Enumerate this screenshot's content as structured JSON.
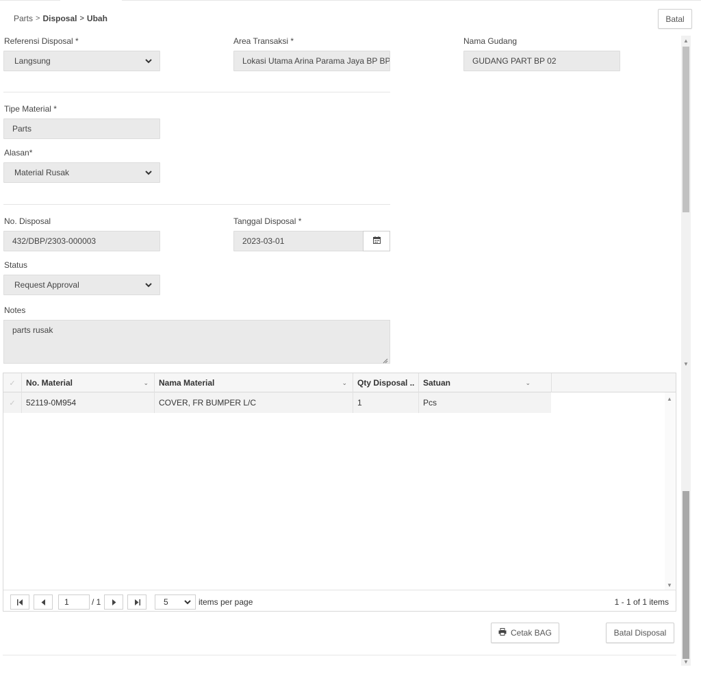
{
  "breadcrumb": {
    "parts": "Parts",
    "disposal": "Disposal",
    "edit": "Ubah",
    "sep": ">"
  },
  "header": {
    "cancel_label": "Batal"
  },
  "form": {
    "referensi_label": "Referensi Disposal *",
    "referensi_value": "Langsung",
    "area_label": "Area Transaksi *",
    "area_value": "Lokasi Utama Arina Parama Jaya BP BP",
    "gudang_label": "Nama Gudang",
    "gudang_value": "GUDANG PART BP 02",
    "tipe_label": "Tipe Material *",
    "tipe_value": "Parts",
    "alasan_label": "Alasan*",
    "alasan_value": "Material Rusak",
    "no_label": "No. Disposal",
    "no_value": "432/DBP/2303-000003",
    "tanggal_label": "Tanggal Disposal *",
    "tanggal_value": "2023-03-01",
    "status_label": "Status",
    "status_value": "Request Approval",
    "notes_label": "Notes",
    "notes_value": "parts rusak"
  },
  "grid": {
    "columns": [
      "No. Material",
      "Nama Material",
      "Qty Disposal ..",
      "Satuan"
    ],
    "rows": [
      {
        "no": "52119-0M954",
        "nama": "COVER, FR BUMPER L/C",
        "qty": "1",
        "satuan": "Pcs"
      }
    ],
    "pager": {
      "page": "1",
      "of": "/ 1",
      "page_size": "5",
      "items_per_page": "items per page",
      "summary": "1 - 1 of 1 items"
    }
  },
  "actions": {
    "cetak_label": "Cetak BAG",
    "batal_disposal_label": "Batal Disposal"
  },
  "icons": {
    "calendar": "calendar-icon",
    "chevron": "chevron-down-icon",
    "print": "printer-icon"
  }
}
